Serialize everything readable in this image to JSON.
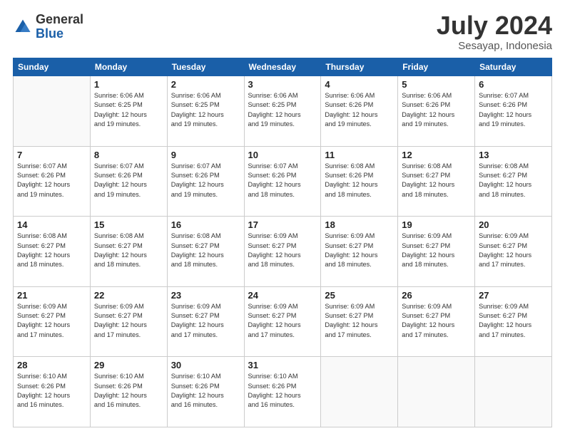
{
  "header": {
    "logo_general": "General",
    "logo_blue": "Blue",
    "month_title": "July 2024",
    "location": "Sesayap, Indonesia"
  },
  "days_of_week": [
    "Sunday",
    "Monday",
    "Tuesday",
    "Wednesday",
    "Thursday",
    "Friday",
    "Saturday"
  ],
  "weeks": [
    [
      {
        "day": "",
        "info": ""
      },
      {
        "day": "1",
        "info": "Sunrise: 6:06 AM\nSunset: 6:25 PM\nDaylight: 12 hours\nand 19 minutes."
      },
      {
        "day": "2",
        "info": "Sunrise: 6:06 AM\nSunset: 6:25 PM\nDaylight: 12 hours\nand 19 minutes."
      },
      {
        "day": "3",
        "info": "Sunrise: 6:06 AM\nSunset: 6:25 PM\nDaylight: 12 hours\nand 19 minutes."
      },
      {
        "day": "4",
        "info": "Sunrise: 6:06 AM\nSunset: 6:26 PM\nDaylight: 12 hours\nand 19 minutes."
      },
      {
        "day": "5",
        "info": "Sunrise: 6:06 AM\nSunset: 6:26 PM\nDaylight: 12 hours\nand 19 minutes."
      },
      {
        "day": "6",
        "info": "Sunrise: 6:07 AM\nSunset: 6:26 PM\nDaylight: 12 hours\nand 19 minutes."
      }
    ],
    [
      {
        "day": "7",
        "info": "Sunrise: 6:07 AM\nSunset: 6:26 PM\nDaylight: 12 hours\nand 19 minutes."
      },
      {
        "day": "8",
        "info": "Sunrise: 6:07 AM\nSunset: 6:26 PM\nDaylight: 12 hours\nand 19 minutes."
      },
      {
        "day": "9",
        "info": "Sunrise: 6:07 AM\nSunset: 6:26 PM\nDaylight: 12 hours\nand 19 minutes."
      },
      {
        "day": "10",
        "info": "Sunrise: 6:07 AM\nSunset: 6:26 PM\nDaylight: 12 hours\nand 18 minutes."
      },
      {
        "day": "11",
        "info": "Sunrise: 6:08 AM\nSunset: 6:26 PM\nDaylight: 12 hours\nand 18 minutes."
      },
      {
        "day": "12",
        "info": "Sunrise: 6:08 AM\nSunset: 6:27 PM\nDaylight: 12 hours\nand 18 minutes."
      },
      {
        "day": "13",
        "info": "Sunrise: 6:08 AM\nSunset: 6:27 PM\nDaylight: 12 hours\nand 18 minutes."
      }
    ],
    [
      {
        "day": "14",
        "info": "Sunrise: 6:08 AM\nSunset: 6:27 PM\nDaylight: 12 hours\nand 18 minutes."
      },
      {
        "day": "15",
        "info": "Sunrise: 6:08 AM\nSunset: 6:27 PM\nDaylight: 12 hours\nand 18 minutes."
      },
      {
        "day": "16",
        "info": "Sunrise: 6:08 AM\nSunset: 6:27 PM\nDaylight: 12 hours\nand 18 minutes."
      },
      {
        "day": "17",
        "info": "Sunrise: 6:09 AM\nSunset: 6:27 PM\nDaylight: 12 hours\nand 18 minutes."
      },
      {
        "day": "18",
        "info": "Sunrise: 6:09 AM\nSunset: 6:27 PM\nDaylight: 12 hours\nand 18 minutes."
      },
      {
        "day": "19",
        "info": "Sunrise: 6:09 AM\nSunset: 6:27 PM\nDaylight: 12 hours\nand 18 minutes."
      },
      {
        "day": "20",
        "info": "Sunrise: 6:09 AM\nSunset: 6:27 PM\nDaylight: 12 hours\nand 17 minutes."
      }
    ],
    [
      {
        "day": "21",
        "info": "Sunrise: 6:09 AM\nSunset: 6:27 PM\nDaylight: 12 hours\nand 17 minutes."
      },
      {
        "day": "22",
        "info": "Sunrise: 6:09 AM\nSunset: 6:27 PM\nDaylight: 12 hours\nand 17 minutes."
      },
      {
        "day": "23",
        "info": "Sunrise: 6:09 AM\nSunset: 6:27 PM\nDaylight: 12 hours\nand 17 minutes."
      },
      {
        "day": "24",
        "info": "Sunrise: 6:09 AM\nSunset: 6:27 PM\nDaylight: 12 hours\nand 17 minutes."
      },
      {
        "day": "25",
        "info": "Sunrise: 6:09 AM\nSunset: 6:27 PM\nDaylight: 12 hours\nand 17 minutes."
      },
      {
        "day": "26",
        "info": "Sunrise: 6:09 AM\nSunset: 6:27 PM\nDaylight: 12 hours\nand 17 minutes."
      },
      {
        "day": "27",
        "info": "Sunrise: 6:09 AM\nSunset: 6:27 PM\nDaylight: 12 hours\nand 17 minutes."
      }
    ],
    [
      {
        "day": "28",
        "info": "Sunrise: 6:10 AM\nSunset: 6:26 PM\nDaylight: 12 hours\nand 16 minutes."
      },
      {
        "day": "29",
        "info": "Sunrise: 6:10 AM\nSunset: 6:26 PM\nDaylight: 12 hours\nand 16 minutes."
      },
      {
        "day": "30",
        "info": "Sunrise: 6:10 AM\nSunset: 6:26 PM\nDaylight: 12 hours\nand 16 minutes."
      },
      {
        "day": "31",
        "info": "Sunrise: 6:10 AM\nSunset: 6:26 PM\nDaylight: 12 hours\nand 16 minutes."
      },
      {
        "day": "",
        "info": ""
      },
      {
        "day": "",
        "info": ""
      },
      {
        "day": "",
        "info": ""
      }
    ]
  ]
}
